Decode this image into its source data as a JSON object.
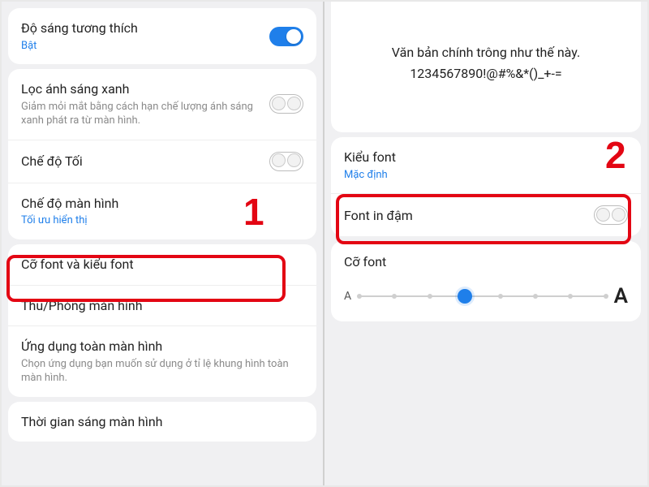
{
  "left": {
    "adaptive_brightness": {
      "title": "Độ sáng tương thích",
      "state": "Bật",
      "on": true
    },
    "blue_light": {
      "title": "Lọc ánh sáng xanh",
      "desc": "Giảm mỏi mắt bằng cách hạn chế lượng ánh sáng xanh phát ra từ màn hình.",
      "on": false
    },
    "dark_mode": {
      "title": "Chế độ Tối",
      "on": false
    },
    "screen_mode": {
      "title": "Chế độ màn hình",
      "value": "Tối ưu hiển thị"
    },
    "font_size_style": {
      "title": "Cỡ font và kiểu font"
    },
    "zoom": {
      "title": "Thu/Phóng màn hình"
    },
    "fullscreen_apps": {
      "title": "Ứng dụng toàn màn hình",
      "desc": "Chọn ứng dụng bạn muốn sử dụng ở tỉ lệ khung hình toàn màn hình."
    },
    "screen_timeout": {
      "title": "Thời gian sáng màn hình"
    }
  },
  "right": {
    "preview_line1": "Văn bản chính trông như thế này.",
    "preview_line2": "1234567890!@#%&*()_+-=",
    "font_style": {
      "title": "Kiểu font",
      "value": "Mặc định"
    },
    "bold_font": {
      "title": "Font in đậm",
      "on": false
    },
    "font_size": {
      "title": "Cỡ font",
      "small_a": "A",
      "big_a": "A",
      "steps": 8,
      "current": 4
    }
  },
  "annotations": {
    "step1": "1",
    "step2": "2"
  }
}
